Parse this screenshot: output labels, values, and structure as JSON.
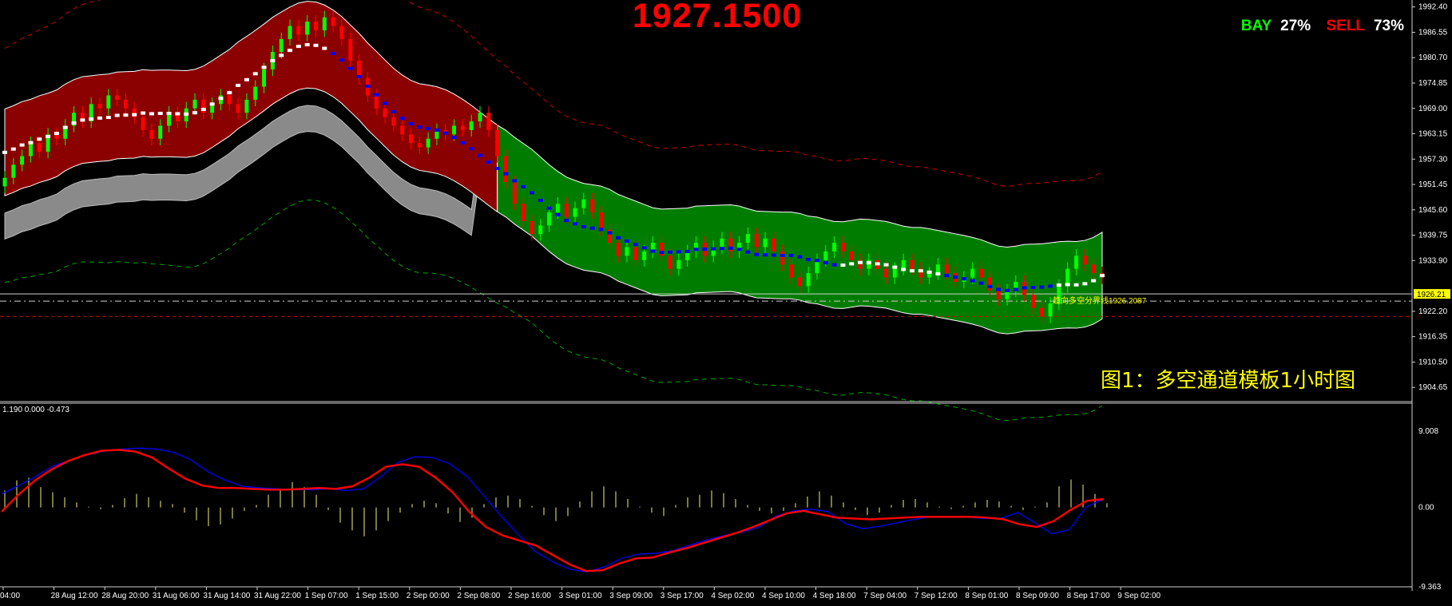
{
  "big_price": "1927.1500",
  "sentiment": {
    "bay_label": "BAY",
    "bay_pct": "27%",
    "sell_label": "SELL",
    "sell_pct": "73%"
  },
  "caption": "图1：多空通道模板1小时图",
  "colors": {
    "background": "#000000",
    "bull": "#00ff00",
    "bear": "#ff0000",
    "channel_red": "#8b0000",
    "channel_green": "#007d00",
    "channel_gray": "#8a8a8a",
    "trend_blue": "#0000ff",
    "macd_signal": "#ff0000",
    "macd_line": "#0000ff",
    "histogram": "#cccc66"
  },
  "current_price_tag": "1926.21",
  "level_label": "趋向多空分界线1926.2087",
  "oscillator_params": "1.190 0.000 -0.473",
  "chart_data": [
    {
      "type": "candlestick",
      "ylim": [
        1901,
        1994
      ],
      "y_ticks": [
        "1992.40",
        "1986.55",
        "1980.70",
        "1974.85",
        "1969.00",
        "1963.15",
        "1957.30",
        "1951.45",
        "1945.60",
        "1939.75",
        "1933.90",
        "1922.20",
        "1916.35",
        "1910.50",
        "1904.65"
      ],
      "x_ticks": [
        "04:00",
        "28 Aug 12:00",
        "28 Aug 20:00",
        "31 Aug 06:00",
        "31 Aug 14:00",
        "31 Aug 22:00",
        "1 Sep 07:00",
        "1 Sep 15:00",
        "2 Sep 00:00",
        "2 Sep 08:00",
        "2 Sep 16:00",
        "3 Sep 01:00",
        "3 Sep 09:00",
        "3 Sep 17:00",
        "4 Sep 02:00",
        "4 Sep 10:00",
        "4 Sep 18:00",
        "7 Sep 04:00",
        "7 Sep 12:00",
        "8 Sep 01:00",
        "8 Sep 09:00",
        "8 Sep 17:00",
        "9 Sep 02:00"
      ],
      "current_price": 1926.21,
      "dividing_line": 1926.2087,
      "series": [
        {
          "name": "close",
          "values": [
            1953,
            1956,
            1958,
            1961,
            1959,
            1963,
            1962,
            1965,
            1968,
            1966,
            1970,
            1969,
            1972,
            1971,
            1969,
            1967,
            1964,
            1962,
            1965,
            1968,
            1966,
            1969,
            1971,
            1968,
            1970,
            1972,
            1970,
            1968,
            1971,
            1974,
            1978,
            1982,
            1985,
            1988,
            1986,
            1989,
            1987,
            1990,
            1988,
            1985,
            1980,
            1976,
            1972,
            1969,
            1967,
            1965,
            1963,
            1961,
            1960,
            1962,
            1964,
            1963,
            1965,
            1964,
            1966,
            1968,
            1964,
            1958,
            1952,
            1947,
            1943,
            1940,
            1942,
            1945,
            1947,
            1944,
            1946,
            1948,
            1945,
            1941,
            1938,
            1935,
            1937,
            1934,
            1936,
            1938,
            1935,
            1932,
            1934,
            1936,
            1938,
            1935,
            1937,
            1939,
            1936,
            1938,
            1940,
            1937,
            1939,
            1936,
            1933,
            1930,
            1928,
            1931,
            1934,
            1936,
            1938,
            1936,
            1934,
            1932,
            1934,
            1932,
            1930,
            1932,
            1934,
            1932,
            1930,
            1931,
            1933,
            1931,
            1929,
            1930,
            1932,
            1930,
            1927,
            1925,
            1927,
            1929,
            1926,
            1923,
            1921,
            1924,
            1928,
            1932,
            1935,
            1933,
            1931,
            1930
          ]
        },
        {
          "name": "macd",
          "values": [
            1.6,
            2.6,
            3.7,
            4.9,
            5.6,
            6.2,
            6.7,
            6.9,
            7.0,
            6.9,
            6.5,
            5.6,
            4.2,
            3.2,
            2.5,
            2.3,
            2.2,
            2.1,
            2.1,
            2.2,
            2.0,
            2.2,
            3.6,
            5.3,
            6.0,
            5.9,
            5.2,
            3.7,
            1.4,
            -1.0,
            -3.2,
            -5.2,
            -6.4,
            -7.3,
            -7.6,
            -7.0,
            -6.0,
            -5.5,
            -5.4,
            -5.1,
            -4.4,
            -3.8,
            -3.3,
            -2.9,
            -2.3,
            -1.0,
            -0.4,
            -0.2,
            -0.5,
            -1.9,
            -2.5,
            -2.2,
            -1.8,
            -1.4,
            -1.1,
            -1.1,
            -1.1,
            -1.3,
            -1.3,
            -0.6,
            -1.8,
            -3.1,
            -2.6,
            0.1,
            1.0
          ]
        },
        {
          "name": "signal",
          "values": [
            -0.5,
            1.5,
            3.2,
            4.5,
            5.5,
            6.2,
            6.7,
            6.8,
            6.6,
            5.9,
            4.6,
            3.4,
            2.6,
            2.3,
            2.3,
            2.2,
            2.1,
            2.1,
            2.2,
            2.3,
            2.2,
            2.5,
            3.5,
            4.8,
            5.1,
            4.8,
            3.5,
            1.8,
            -0.5,
            -2.3,
            -3.3,
            -3.9,
            -4.5,
            -5.6,
            -6.7,
            -7.5,
            -7.4,
            -6.6,
            -6.0,
            -5.9,
            -5.3,
            -4.8,
            -4.2,
            -3.6,
            -3.0,
            -2.3,
            -1.5,
            -0.7,
            -0.4,
            -0.8,
            -1.2,
            -1.3,
            -1.4,
            -1.3,
            -1.2,
            -1.1,
            -1.1,
            -1.1,
            -1.1,
            -1.2,
            -1.4,
            -2.0,
            -2.3,
            -1.6,
            -0.3,
            0.8,
            1.0
          ]
        }
      ]
    },
    {
      "type": "bar",
      "name": "histogram",
      "ylim": [
        -9.363,
        9.008
      ],
      "y_ticks": [
        "9.008",
        "0.00",
        "-9.363"
      ],
      "values": [
        2,
        3.2,
        3.5,
        2.4,
        1.8,
        1.2,
        0.6,
        0.1,
        -0.2,
        0.3,
        1.1,
        1.6,
        1.2,
        0.8,
        0.4,
        -0.6,
        -1.5,
        -2.2,
        -2.0,
        -1.3,
        -0.4,
        0.3,
        1.5,
        2.2,
        3.0,
        2.4,
        1.5,
        -0.3,
        -1.8,
        -2.7,
        -3.4,
        -2.7,
        -1.6,
        -0.6,
        0.4,
        0.8,
        0.5,
        -0.7,
        -1.7,
        -1.2,
        0.4,
        1.2,
        1.4,
        1.0,
        0.2,
        -0.9,
        -1.6,
        -1.0,
        0.7,
        1.9,
        2.5,
        1.9,
        1.0,
        0.1,
        -0.6,
        -1.0,
        0.3,
        1.2,
        1.5,
        2.0,
        1.7,
        1.0,
        0.3,
        -0.4,
        -0.7,
        -0.4,
        0.5,
        1.3,
        1.9,
        1.4,
        0.6,
        -0.3,
        -0.9,
        -0.6,
        0.3,
        0.9,
        1.0,
        0.6,
        0.1,
        -0.2,
        0.2,
        0.6,
        0.9,
        0.7,
        0.2,
        -0.3,
        0.1,
        0.6,
        2.5,
        3.3,
        2.7,
        1.6,
        0.5
      ]
    }
  ]
}
